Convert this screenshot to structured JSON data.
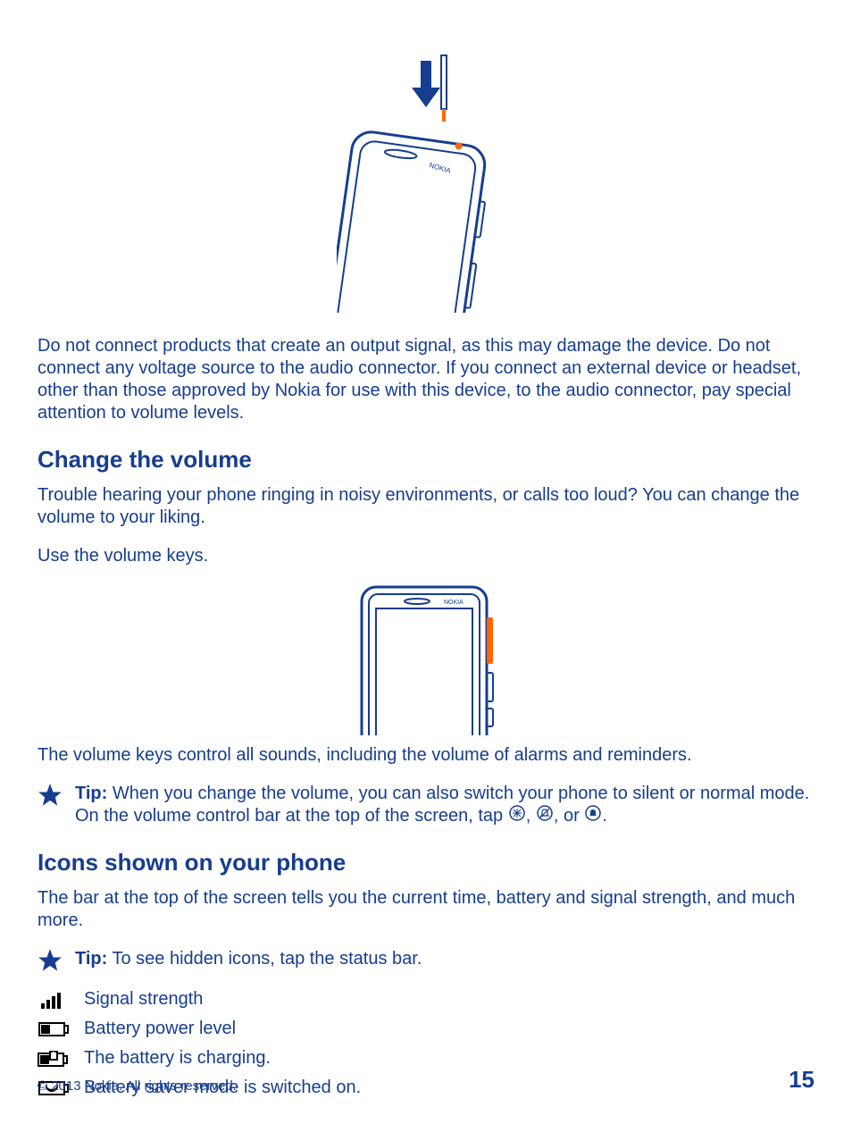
{
  "colors": {
    "primary": "#163d8f",
    "accent": "#ff6600"
  },
  "warning_paragraph": "Do not connect products that create an output signal, as this may damage the device. Do not connect any voltage source to the audio connector. If you connect an external device or headset, other than those approved by Nokia for use with this device, to the audio connector, pay special attention to volume levels.",
  "section_volume": {
    "heading": "Change the volume",
    "p1": "Trouble hearing your phone ringing in noisy environments, or calls too loud? You can change the volume to your liking.",
    "p2": "Use the volume keys.",
    "p3": "The volume keys control all sounds, including the volume of alarms and reminders.",
    "tip_label": "Tip:",
    "tip_text_1": " When you change the volume, you can also switch your phone to silent or normal mode. On the volume control bar at the top of the screen, tap ",
    "tip_sep1": ", ",
    "tip_sep2": ", or ",
    "tip_end": "."
  },
  "section_icons": {
    "heading": "Icons shown on your phone",
    "p1": "The bar at the top of the screen tells you the current time, battery and signal strength, and much more.",
    "tip_label": "Tip:",
    "tip_text": " To see hidden icons, tap the status bar.",
    "items": {
      "signal": "Signal strength",
      "battery": "Battery power level",
      "charging": "The battery is charging.",
      "saver": "Battery saver mode is switched on."
    }
  },
  "footer": {
    "copyright": "© 2013 Nokia. All rights reserved.",
    "page": "15"
  }
}
